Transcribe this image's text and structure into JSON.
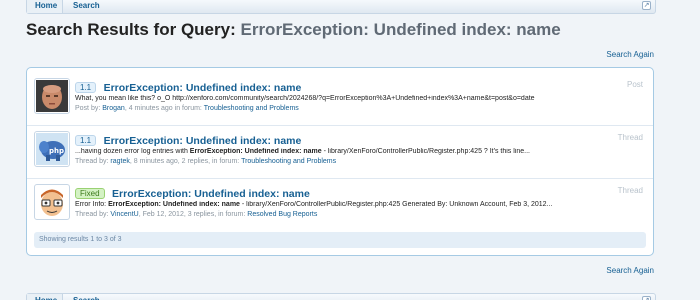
{
  "breadcrumb": {
    "items": [
      "Home",
      "Search"
    ]
  },
  "page": {
    "title_prefix": "Search Results for Query:",
    "query": "ErrorException: Undefined index: name",
    "search_again": "Search Again"
  },
  "results": [
    {
      "prefix": "1.1",
      "prefix_style": "ver",
      "title": "ErrorException: Undefined index: name",
      "type": "Post",
      "snippet_plain": "What, you mean like this? o_O http://xenforo.com/community/search/2024268/?q=ErrorException%3A+Undefined+index%3A+name&t=post&o=date",
      "meta_prefix": "Post by:",
      "author": "Brogan",
      "meta_middle": ", 4 minutes ago in forum:",
      "forum": "Troubleshooting and Problems"
    },
    {
      "prefix": "1.1",
      "prefix_style": "ver",
      "title": "ErrorException: Undefined index: name",
      "type": "Thread",
      "snippet_before": "...having dozen error log entries with ",
      "snippet_bold": "ErrorException: Undefined index: name",
      "snippet_after": " - library/XenForo/ControllerPublic/Register.php:425 ? It's this line...",
      "meta_prefix": "Thread by:",
      "author": "ragtek",
      "meta_middle": ", 8 minutes ago, 2 replies, in forum:",
      "forum": "Troubleshooting and Problems"
    },
    {
      "prefix": "Fixed",
      "prefix_style": "fixed",
      "title": "ErrorException: Undefined index: name",
      "type": "Thread",
      "snippet_before": "Error Info: ",
      "snippet_bold": "ErrorException: Undefined index: name",
      "snippet_after": " - library/XenForo/ControllerPublic/Register.php:425 Generated By: Unknown Account, Feb 3, 2012...",
      "meta_prefix": "Thread by:",
      "author": "VincentU",
      "meta_middle": ", Feb 12, 2012, 3 replies, in forum:",
      "forum": "Resolved Bug Reports"
    }
  ],
  "pager": {
    "text": "Showing results 1 to 3 of 3"
  },
  "icons": {
    "jump": "jump-to-top-icon",
    "arrow": "breadcrumb-arrow-icon"
  },
  "colors": {
    "link": "#176093",
    "border": "#a5cae4",
    "fixed_bg": "#d4f2c4",
    "fixed_text": "#3d7a1c"
  }
}
